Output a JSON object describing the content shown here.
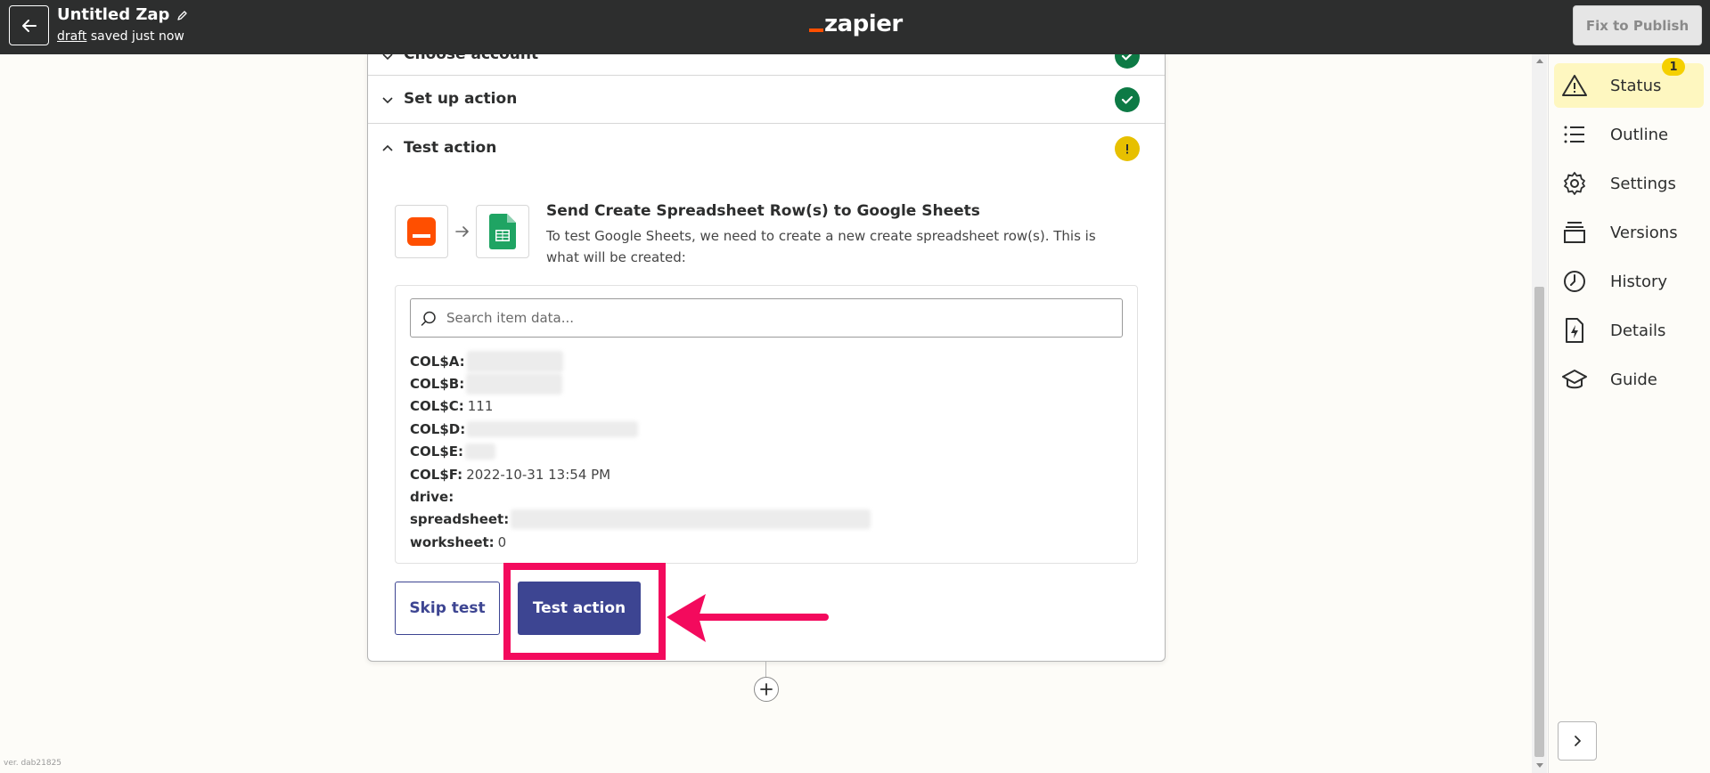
{
  "header": {
    "title": "Untitled Zap",
    "draft_link": "draft",
    "saved_text": "saved just now",
    "logo_text": "zapier",
    "publish_label": "Fix to Publish"
  },
  "steps": {
    "choose_account": "Choose account",
    "setup_action": "Set up action",
    "test_action": "Test action"
  },
  "test_panel": {
    "title": "Send Create Spreadsheet Row(s) to Google Sheets",
    "description": "To test Google Sheets, we need to create a new create spreadsheet row(s). This is what will be created:",
    "search_placeholder": "Search item data...",
    "fields": [
      {
        "key": "COL$A:",
        "value": ""
      },
      {
        "key": "COL$B:",
        "value": ""
      },
      {
        "key": "COL$C:",
        "value": "111"
      },
      {
        "key": "COL$D:",
        "value": ""
      },
      {
        "key": "COL$E:",
        "value": ""
      },
      {
        "key": "COL$F:",
        "value": "2022-10-31 13:54 PM"
      },
      {
        "key": "drive:",
        "value": ""
      },
      {
        "key": "spreadsheet:",
        "value": ""
      },
      {
        "key": "worksheet:",
        "value": "0"
      }
    ],
    "skip_label": "Skip test",
    "test_label": "Test action"
  },
  "sidebar": {
    "status_badge": "1",
    "items": [
      {
        "label": "Status",
        "icon": "warning-icon"
      },
      {
        "label": "Outline",
        "icon": "list-icon"
      },
      {
        "label": "Settings",
        "icon": "gear-icon"
      },
      {
        "label": "Versions",
        "icon": "layers-icon"
      },
      {
        "label": "History",
        "icon": "clock-icon"
      },
      {
        "label": "Details",
        "icon": "file-bolt-icon"
      },
      {
        "label": "Guide",
        "icon": "graduation-cap-icon"
      }
    ]
  },
  "footer": {
    "version": "ver. dab21825"
  },
  "colors": {
    "topbar": "#2d2e2e",
    "accent": "#3d4592",
    "brand_orange": "#ff4f00",
    "success": "#0d7a45",
    "warning": "#e7c000",
    "highlight": "#f30a5d",
    "active_sidebar": "#fef7c0"
  }
}
